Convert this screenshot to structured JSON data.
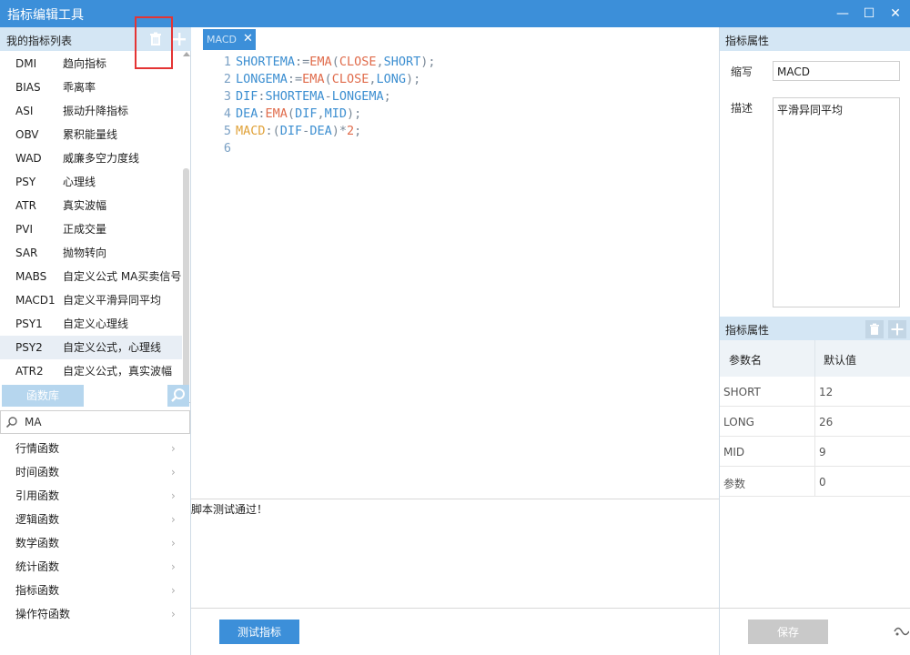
{
  "window": {
    "title": "指标编辑工具",
    "minimize_label": "—",
    "maximize_label": "☐",
    "close_label": "✕"
  },
  "left": {
    "header": "我的指标列表",
    "indicators": [
      {
        "code": "DMI",
        "name": "趋向指标"
      },
      {
        "code": "BIAS",
        "name": "乖离率"
      },
      {
        "code": "ASI",
        "name": "振动升降指标"
      },
      {
        "code": "OBV",
        "name": "累积能量线"
      },
      {
        "code": "WAD",
        "name": "威廉多空力度线"
      },
      {
        "code": "PSY",
        "name": "心理线"
      },
      {
        "code": "ATR",
        "name": "真实波幅"
      },
      {
        "code": "PVI",
        "name": "正成交量"
      },
      {
        "code": "SAR",
        "name": "抛物转向"
      },
      {
        "code": "MABS",
        "name": "自定义公式 MA买卖信号"
      },
      {
        "code": "MACD1",
        "name": "自定义平滑异同平均"
      },
      {
        "code": "PSY1",
        "name": "自定义心理线"
      },
      {
        "code": "PSY2",
        "name": "自定义公式，心理线"
      },
      {
        "code": "ATR2",
        "name": "自定义公式，真实波幅"
      }
    ],
    "selected_index": 12,
    "func_tab": "函数库",
    "search_value": "MA",
    "functions": [
      "行情函数",
      "时间函数",
      "引用函数",
      "逻辑函数",
      "数学函数",
      "统计函数",
      "指标函数",
      "操作符函数"
    ]
  },
  "editor": {
    "tab_label": "MACD",
    "tab_close": "✕",
    "lines": [
      {
        "n": "1",
        "tokens": [
          {
            "t": "SHORTEMA",
            "c": "id"
          },
          {
            "t": ":=",
            "c": "op"
          },
          {
            "t": "EMA",
            "c": "fn"
          },
          {
            "t": "(",
            "c": "op"
          },
          {
            "t": "CLOSE",
            "c": "fn"
          },
          {
            "t": ",",
            "c": "op"
          },
          {
            "t": "SHORT",
            "c": "id"
          },
          {
            "t": ");",
            "c": "op"
          }
        ]
      },
      {
        "n": "2",
        "tokens": [
          {
            "t": "LONGEMA",
            "c": "id"
          },
          {
            "t": ":=",
            "c": "op"
          },
          {
            "t": "EMA",
            "c": "fn"
          },
          {
            "t": "(",
            "c": "op"
          },
          {
            "t": "CLOSE",
            "c": "fn"
          },
          {
            "t": ",",
            "c": "op"
          },
          {
            "t": "LONG",
            "c": "id"
          },
          {
            "t": ");",
            "c": "op"
          }
        ]
      },
      {
        "n": "3",
        "tokens": [
          {
            "t": "DIF",
            "c": "id"
          },
          {
            "t": ":",
            "c": "op"
          },
          {
            "t": "SHORTEMA",
            "c": "id"
          },
          {
            "t": "-",
            "c": "op"
          },
          {
            "t": "LONGEMA",
            "c": "id"
          },
          {
            "t": ";",
            "c": "op"
          }
        ]
      },
      {
        "n": "4",
        "tokens": [
          {
            "t": "DEA",
            "c": "id"
          },
          {
            "t": ":",
            "c": "op"
          },
          {
            "t": "EMA",
            "c": "fn"
          },
          {
            "t": "(",
            "c": "op"
          },
          {
            "t": "DIF",
            "c": "id"
          },
          {
            "t": ",",
            "c": "op"
          },
          {
            "t": "MID",
            "c": "id"
          },
          {
            "t": ");",
            "c": "op"
          }
        ]
      },
      {
        "n": "5",
        "tokens": [
          {
            "t": "MACD",
            "c": "var"
          },
          {
            "t": ":(",
            "c": "op"
          },
          {
            "t": "DIF",
            "c": "id"
          },
          {
            "t": "-",
            "c": "op"
          },
          {
            "t": "DEA",
            "c": "id"
          },
          {
            "t": ")*",
            "c": "op"
          },
          {
            "t": "2",
            "c": "num"
          },
          {
            "t": ";",
            "c": "op"
          }
        ]
      },
      {
        "n": "6",
        "tokens": []
      }
    ],
    "output": "脚本测试通过！",
    "test_button": "测试指标"
  },
  "right": {
    "props_header": "指标属性",
    "abbr_label": "缩写",
    "abbr_value": "MACD",
    "desc_label": "描述",
    "desc_value": "平滑异同平均",
    "params_header": "指标属性",
    "col_name": "参数名",
    "col_default": "默认值",
    "params": [
      {
        "name": "SHORT",
        "value": "12"
      },
      {
        "name": "LONG",
        "value": "26"
      },
      {
        "name": "MID",
        "value": "9"
      },
      {
        "name": "参数",
        "value": "0"
      }
    ],
    "save_button": "保存"
  }
}
